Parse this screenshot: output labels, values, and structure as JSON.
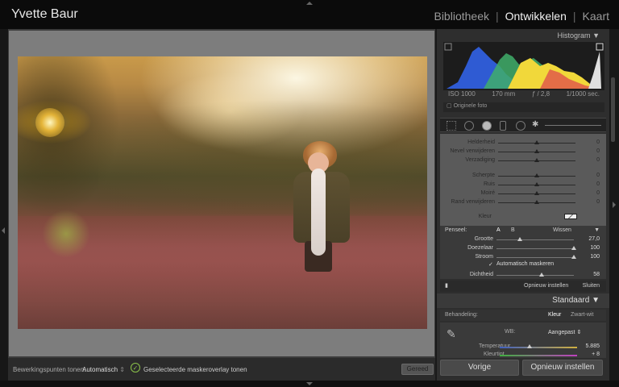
{
  "app": {
    "user_name": "Yvette Baur"
  },
  "modules": [
    {
      "label": "Bibliotheek",
      "active": false
    },
    {
      "label": "Ontwikkelen",
      "active": true
    },
    {
      "label": "Kaart",
      "active": false
    }
  ],
  "histogram": {
    "title": "Histogram",
    "iso": "ISO 1000",
    "focal": "170 mm",
    "aperture": "ƒ / 2,8",
    "shutter": "1/1000 sec.",
    "original_photo_label": "Originele foto"
  },
  "mask_sliders": [
    {
      "label": "Helderheid",
      "value": "0",
      "level": 0.5
    },
    {
      "label": "Nevel verwijderen",
      "value": "0",
      "level": 0.5
    },
    {
      "label": "Verzadiging",
      "value": "0",
      "level": 0.5
    },
    {
      "label": "Scherpte",
      "value": "0",
      "level": 0.5
    },
    {
      "label": "Ruis",
      "value": "0",
      "level": 0.5
    },
    {
      "label": "Moiré",
      "value": "0",
      "level": 0.5
    },
    {
      "label": "Rand verwijderen",
      "value": "0",
      "level": 0.5
    }
  ],
  "color_label": "Kleur",
  "brush": {
    "label": "Penseel:",
    "a": "A",
    "b": "B",
    "clear": "Wissen",
    "sliders": [
      {
        "label": "Grootte",
        "value": "27,0",
        "level": 0.3
      },
      {
        "label": "Doezelaar",
        "value": "100",
        "level": 1.0
      },
      {
        "label": "Stroom",
        "value": "100",
        "level": 1.0
      },
      {
        "label": "Dichtheid",
        "value": "58",
        "level": 0.58
      }
    ],
    "auto_mask": "Automatisch maskeren"
  },
  "panel_actions": {
    "reset": "Opnieuw instellen",
    "close": "Sluiten"
  },
  "standard": {
    "title": "Standaard"
  },
  "treatment": {
    "label": "Behandeling:",
    "color": "Kleur",
    "bw": "Zwart-wit"
  },
  "wb": {
    "label": "WB:",
    "value": "Aangepast",
    "temp_label": "Temperatuur",
    "temp_value": "5.885",
    "tint_label": "Kleurtint",
    "tint_value": "+ 8"
  },
  "bottom_buttons": {
    "previous": "Vorige",
    "reset": "Opnieuw instellen"
  },
  "toolbar": {
    "edit_points_label": "Bewerkingspunten tonen:",
    "edit_points_value": "Automatisch",
    "overlay_label": "Geselecteerde maskeroverlay tonen",
    "done": "Gereed"
  },
  "colors": {
    "accent": "#8bc34a",
    "panel": "#5a5a5a"
  }
}
